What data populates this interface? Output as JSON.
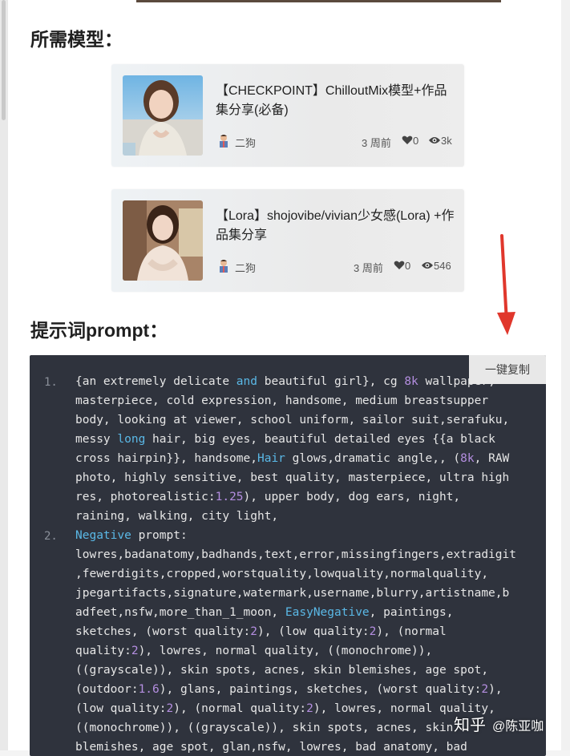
{
  "sections": {
    "models_heading": "所需模型：",
    "prompt_heading": "提示词prompt："
  },
  "cards": [
    {
      "title": "【CHECKPOINT】ChilloutMix模型+作品集分享(必备)",
      "author": "二狗",
      "time": "3 周前",
      "likes": "0",
      "views": "3k"
    },
    {
      "title": "【Lora】shojovibe/vivian少女感(Lora) +作品集分享",
      "author": "二狗",
      "time": "3 周前",
      "likes": "0",
      "views": "546"
    }
  ],
  "code": {
    "copy_label": "一键复制",
    "line_numbers": [
      "1.",
      "2."
    ]
  },
  "watermark": {
    "site": "知乎",
    "user": "@陈亚咖"
  },
  "colors": {
    "code_bg": "#2f333d",
    "keyword": "#5ab8e6",
    "number": "#b48ee0",
    "arrow": "#e0372c"
  }
}
